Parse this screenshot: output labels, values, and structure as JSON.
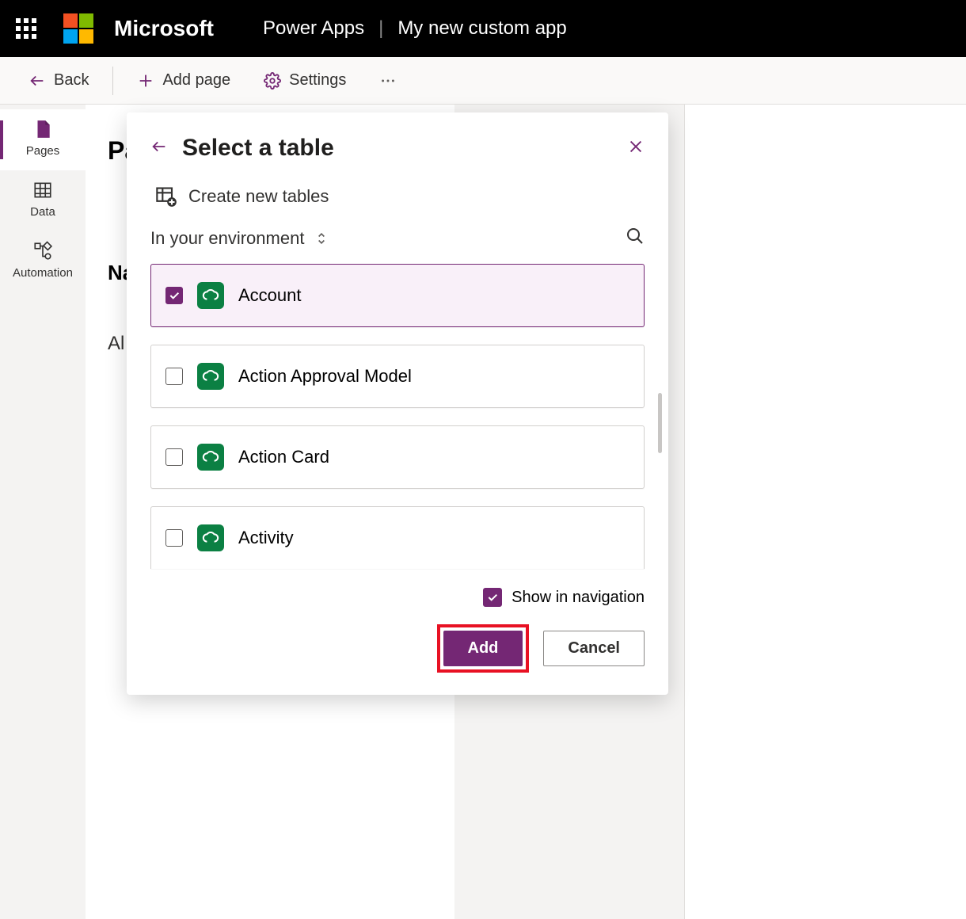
{
  "header": {
    "brand": "Microsoft",
    "product": "Power Apps",
    "appName": "My new custom app"
  },
  "toolbar": {
    "back": "Back",
    "addPage": "Add page",
    "settings": "Settings"
  },
  "leftRail": {
    "pages": "Pages",
    "data": "Data",
    "automation": "Automation"
  },
  "content": {
    "pageHeading": "Pa",
    "nameLabel": "Na",
    "allLabel": "Al"
  },
  "modal": {
    "title": "Select a table",
    "createNew": "Create new tables",
    "envLabel": "In your environment",
    "tables": [
      {
        "label": "Account",
        "selected": true
      },
      {
        "label": "Action Approval Model",
        "selected": false
      },
      {
        "label": "Action Card",
        "selected": false
      },
      {
        "label": "Activity",
        "selected": false
      }
    ],
    "showInNav": "Show in navigation",
    "add": "Add",
    "cancel": "Cancel"
  }
}
